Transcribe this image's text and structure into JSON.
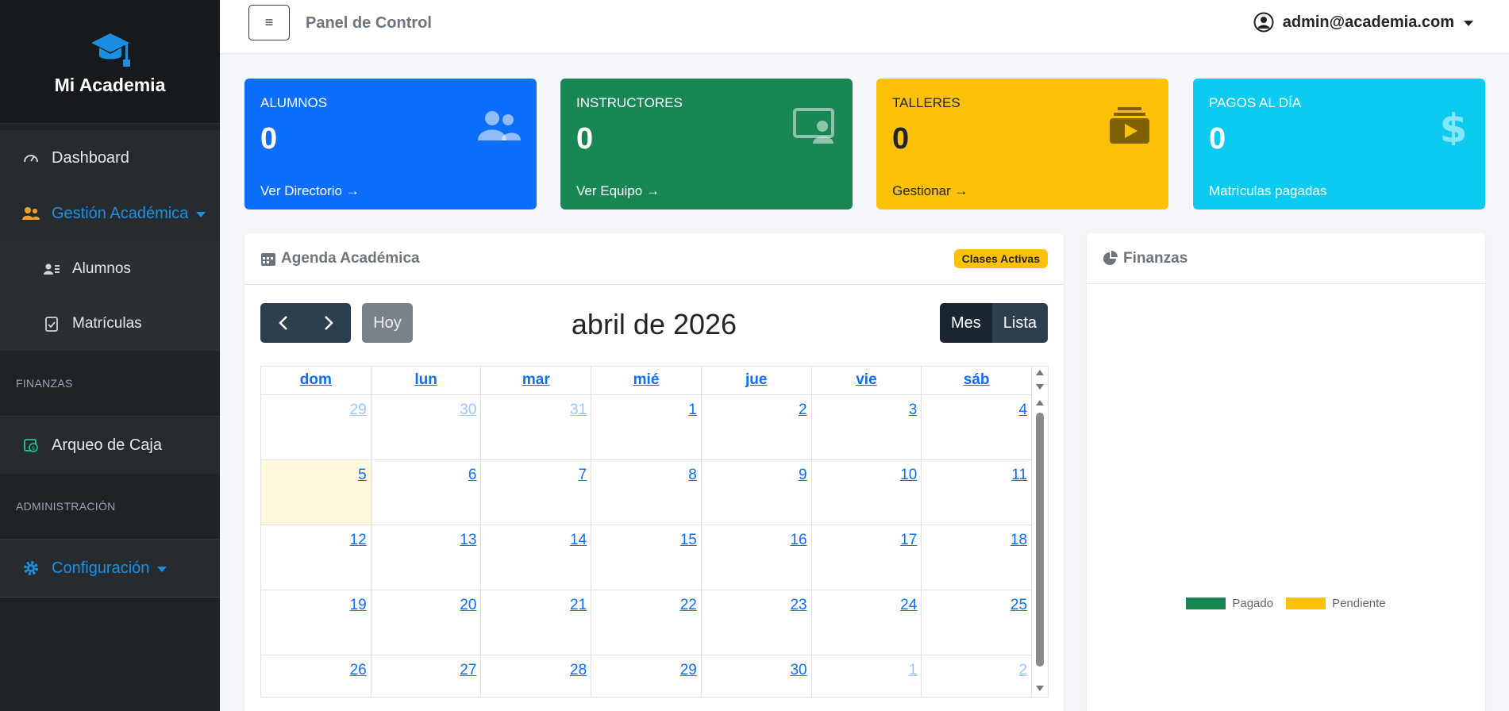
{
  "sidebar": {
    "brand": "Mi Academia",
    "items": {
      "dashboard": "Dashboard",
      "gestion": "Gestión Académica",
      "alumnos": "Alumnos",
      "matriculas": "Matrículas",
      "finanzas_header": "FINANZAS",
      "arqueo": "Arqueo de Caja",
      "admin_header": "ADMINISTRACIÓN",
      "config": "Configuración"
    }
  },
  "topbar": {
    "toggle": "≡",
    "title": "Panel de Control",
    "user": "admin@academia.com"
  },
  "stats": [
    {
      "label": "ALUMNOS",
      "value": "0",
      "link": "Ver Directorio →",
      "icon": "users-icon",
      "color": "#0d6efd"
    },
    {
      "label": "INSTRUCTORES",
      "value": "0",
      "link": "Ver Equipo →",
      "icon": "chalkboard-teacher-icon",
      "color": "#198754"
    },
    {
      "label": "TALLERES",
      "value": "0",
      "link": "Gestionar →",
      "icon": "video-playlist-icon",
      "color": "#ffc107"
    },
    {
      "label": "PAGOS AL DÍA",
      "value": "0",
      "link": "Matrículas pagadas",
      "icon": "dollar-icon",
      "color": "#0dcaf0"
    }
  ],
  "agenda": {
    "title": "Agenda Académica",
    "badge": "Clases Activas",
    "today": "Hoy",
    "month_title": "abril de 2026",
    "view_month": "Mes",
    "view_list": "Lista",
    "dow": [
      "dom",
      "lun",
      "mar",
      "mié",
      "jue",
      "vie",
      "sáb"
    ],
    "weeks": [
      [
        "29",
        "30",
        "31",
        "1",
        "2",
        "3",
        "4"
      ],
      [
        "5",
        "6",
        "7",
        "8",
        "9",
        "10",
        "11"
      ],
      [
        "12",
        "13",
        "14",
        "15",
        "16",
        "17",
        "18"
      ],
      [
        "19",
        "20",
        "21",
        "22",
        "23",
        "24",
        "25"
      ],
      [
        "26",
        "27",
        "28",
        "29",
        "30",
        "1",
        "2"
      ]
    ]
  },
  "finanzas": {
    "title": "Finanzas",
    "legend": [
      {
        "label": "Pagado",
        "color": "#198754"
      },
      {
        "label": "Pendiente",
        "color": "#ffc107"
      }
    ]
  }
}
